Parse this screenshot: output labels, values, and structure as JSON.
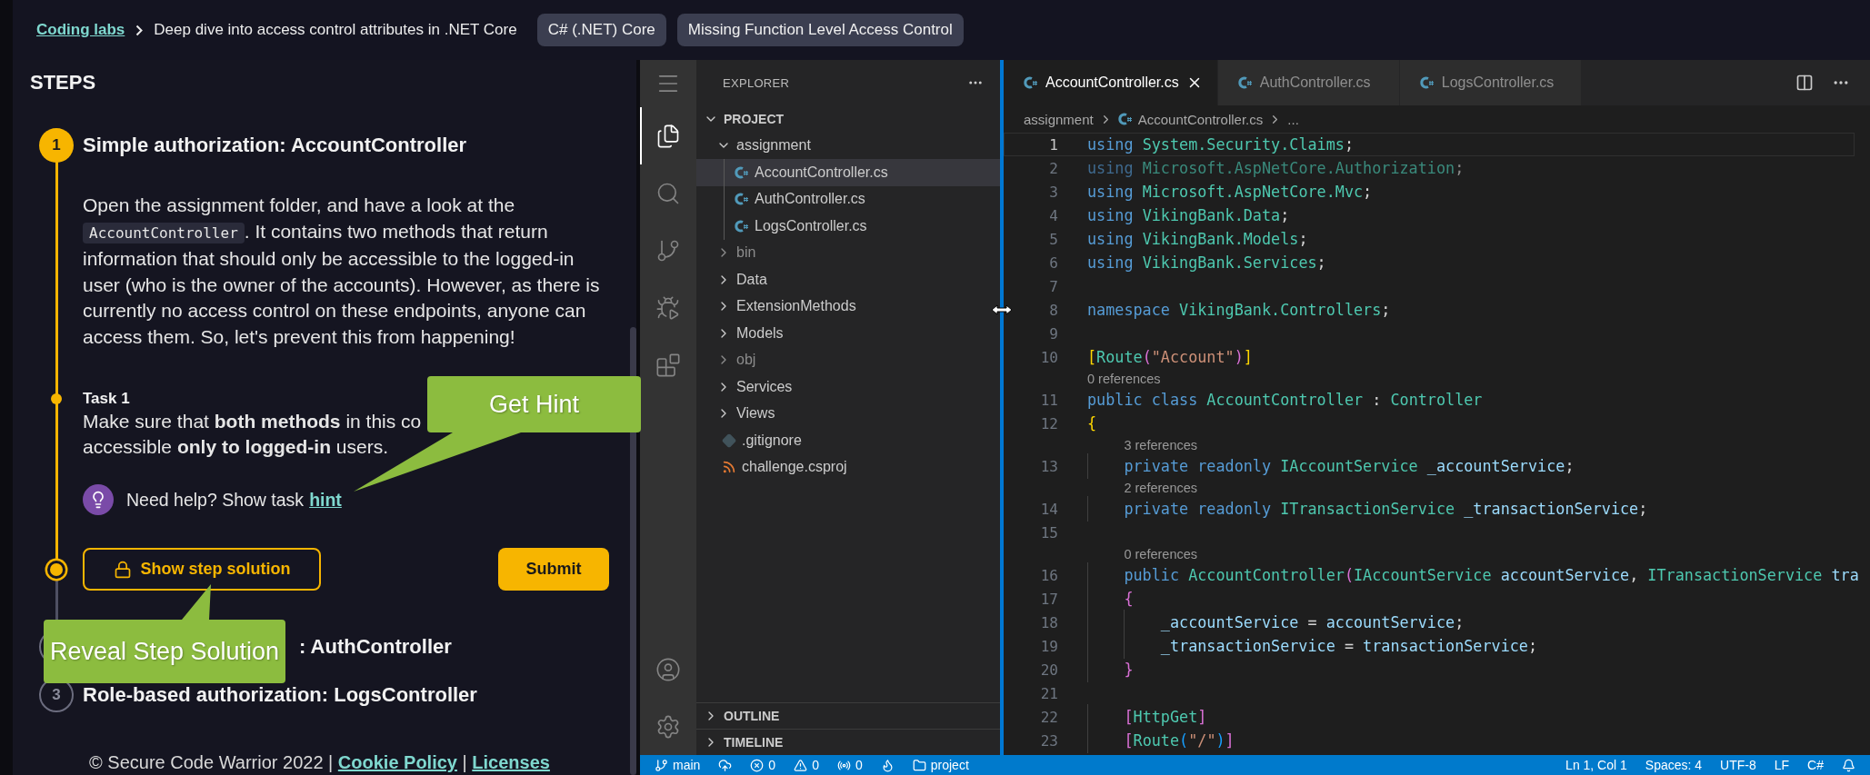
{
  "header": {
    "breadcrumb": {
      "link": "Coding labs",
      "current": "Deep dive into access control attributes in .NET Core"
    },
    "tags": [
      "C# (.NET) Core",
      "Missing Function Level Access Control"
    ]
  },
  "steps_panel": {
    "title": "STEPS",
    "steps": [
      {
        "number": "1",
        "title": "Simple authorization: AccountController",
        "active": true,
        "covered": false,
        "description": [
          {
            "kind": "text",
            "text": "Open the assignment folder, and have a look at the "
          },
          {
            "kind": "code",
            "text": "AccountController"
          },
          {
            "kind": "text",
            "text": ". It contains two methods that return information that should only be accessible to the logged-in user (who is the owner of the accounts). However, as there is currently no access control on these endpoints, anyone can access them. So, let's prevent this from happening!"
          }
        ],
        "task": {
          "label": "Task 1",
          "lines": [
            "Make sure that **both methods** in this co",
            "accessible **only to logged-in** users."
          ]
        },
        "hint": {
          "prompt": "Need help? Show task",
          "link": "hint"
        },
        "actions": [
          {
            "kind": "reveal",
            "label": "Show step solution"
          },
          {
            "kind": "submit",
            "label": "Submit"
          }
        ]
      },
      {
        "title": ": AuthController",
        "active": false,
        "covered": true
      },
      {
        "number": "3",
        "title": "Role-based authorization: LogsController",
        "active": false,
        "covered": false
      }
    ],
    "footer": [
      {
        "kind": "text",
        "text": "© Secure Code Warrior 2022 |"
      },
      {
        "kind": "link",
        "text": "Cookie Policy"
      },
      {
        "kind": "text",
        "text": "|"
      },
      {
        "kind": "link",
        "text": "Licenses"
      }
    ]
  },
  "callouts": [
    {
      "kind": "hint",
      "text": "Get Hint"
    },
    {
      "kind": "solution",
      "text": "Reveal Step Solution"
    }
  ],
  "ide": {
    "activity_bar": [
      {
        "kind": "menu",
        "selected": false
      },
      {
        "kind": "explorer",
        "selected": true
      },
      {
        "kind": "search",
        "selected": false
      },
      {
        "kind": "source-control",
        "selected": false
      },
      {
        "kind": "run-debug",
        "selected": false
      },
      {
        "kind": "extensions",
        "selected": false
      },
      {
        "kind": "accounts",
        "selected": false
      },
      {
        "kind": "settings",
        "selected": false
      }
    ],
    "explorer": {
      "title": "EXPLORER",
      "tree": [
        {
          "label": "PROJECT",
          "kind": "root",
          "expanded": true,
          "selected": false,
          "dimmed": false,
          "children": [
            {
              "label": "assignment",
              "kind": "folder",
              "expanded": true,
              "selected": false,
              "dimmed": false,
              "children": [
                {
                  "label": "AccountController.cs",
                  "kind": "csharp",
                  "selected": true,
                  "dimmed": false
                },
                {
                  "label": "AuthController.cs",
                  "kind": "csharp",
                  "selected": false,
                  "dimmed": false
                },
                {
                  "label": "LogsController.cs",
                  "kind": "csharp",
                  "selected": false,
                  "dimmed": false
                }
              ]
            },
            {
              "label": "bin",
              "kind": "folder",
              "expanded": false,
              "selected": false,
              "dimmed": true
            },
            {
              "label": "Data",
              "kind": "folder",
              "expanded": false,
              "selected": false,
              "dimmed": false
            },
            {
              "label": "ExtensionMethods",
              "kind": "folder",
              "expanded": false,
              "selected": false,
              "dimmed": false
            },
            {
              "label": "Models",
              "kind": "folder",
              "expanded": false,
              "selected": false,
              "dimmed": false
            },
            {
              "label": "obj",
              "kind": "folder",
              "expanded": false,
              "selected": false,
              "dimmed": true
            },
            {
              "label": "Services",
              "kind": "folder",
              "expanded": false,
              "selected": false,
              "dimmed": false
            },
            {
              "label": "Views",
              "kind": "folder",
              "expanded": false,
              "selected": false,
              "dimmed": false
            },
            {
              "label": ".gitignore",
              "kind": "git",
              "selected": false,
              "dimmed": false
            },
            {
              "label": "challenge.csproj",
              "kind": "project",
              "selected": false,
              "dimmed": false
            }
          ]
        }
      ],
      "sections": [
        {
          "label": "OUTLINE",
          "expanded": false
        },
        {
          "label": "TIMELINE",
          "expanded": false
        }
      ]
    },
    "tabs": [
      {
        "label": "AccountController.cs",
        "selected": true
      },
      {
        "label": "AuthController.cs",
        "selected": false
      },
      {
        "label": "LogsController.cs",
        "selected": false
      }
    ],
    "breadcrumb": [
      "assignment",
      "AccountController.cs",
      "..."
    ],
    "code": [
      {
        "kind": "code",
        "number": "1",
        "current": true,
        "unused": false,
        "tokens": [
          {
            "text": "using ",
            "kind": "kw"
          },
          {
            "text": "System.Security.Claims",
            "kind": "type"
          },
          {
            "text": ";",
            "kind": "plain"
          }
        ]
      },
      {
        "kind": "code",
        "number": "2",
        "current": false,
        "unused": true,
        "tokens": [
          {
            "text": "using ",
            "kind": "kw"
          },
          {
            "text": "Microsoft.AspNetCore.Authorization",
            "kind": "type"
          },
          {
            "text": ";",
            "kind": "plain"
          }
        ]
      },
      {
        "kind": "code",
        "number": "3",
        "current": false,
        "unused": false,
        "tokens": [
          {
            "text": "using ",
            "kind": "kw"
          },
          {
            "text": "Microsoft.AspNetCore.Mvc",
            "kind": "type"
          },
          {
            "text": ";",
            "kind": "plain"
          }
        ]
      },
      {
        "kind": "code",
        "number": "4",
        "current": false,
        "unused": false,
        "tokens": [
          {
            "text": "using ",
            "kind": "kw"
          },
          {
            "text": "VikingBank.Data",
            "kind": "type"
          },
          {
            "text": ";",
            "kind": "plain"
          }
        ]
      },
      {
        "kind": "code",
        "number": "5",
        "current": false,
        "unused": false,
        "tokens": [
          {
            "text": "using ",
            "kind": "kw"
          },
          {
            "text": "VikingBank.Models",
            "kind": "type"
          },
          {
            "text": ";",
            "kind": "plain"
          }
        ]
      },
      {
        "kind": "code",
        "number": "6",
        "current": false,
        "unused": false,
        "tokens": [
          {
            "text": "using ",
            "kind": "kw"
          },
          {
            "text": "VikingBank.Services",
            "kind": "type"
          },
          {
            "text": ";",
            "kind": "plain"
          }
        ]
      },
      {
        "kind": "code",
        "number": "7",
        "current": false
      },
      {
        "kind": "code",
        "number": "8",
        "current": false,
        "unused": false,
        "tokens": [
          {
            "text": "namespace ",
            "kind": "kw"
          },
          {
            "text": "VikingBank.Controllers",
            "kind": "type"
          },
          {
            "text": ";",
            "kind": "plain"
          }
        ]
      },
      {
        "kind": "code",
        "number": "9",
        "current": false
      },
      {
        "kind": "code",
        "number": "10",
        "current": false,
        "unused": false,
        "tokens": [
          {
            "text": "[",
            "kind": "bracket1"
          },
          {
            "text": "Route",
            "kind": "type"
          },
          {
            "text": "(",
            "kind": "bracket2"
          },
          {
            "text": "\"Account\"",
            "kind": "str"
          },
          {
            "text": ")",
            "kind": "bracket2"
          },
          {
            "text": "]",
            "kind": "bracket1"
          }
        ]
      },
      {
        "kind": "lens",
        "text": "0 references"
      },
      {
        "kind": "code",
        "number": "11",
        "current": false,
        "unused": false,
        "tokens": [
          {
            "text": "public class ",
            "kind": "kw"
          },
          {
            "text": "AccountController",
            "kind": "type"
          },
          {
            "text": " : ",
            "kind": "plain"
          },
          {
            "text": "Controller",
            "kind": "type"
          }
        ]
      },
      {
        "kind": "code",
        "number": "12",
        "current": false,
        "unused": false,
        "tokens": [
          {
            "text": "{",
            "kind": "bracket1"
          }
        ]
      },
      {
        "kind": "lens",
        "text": "3 references"
      },
      {
        "kind": "code",
        "number": "13",
        "current": false,
        "unused": false,
        "tokens": [
          {
            "text": "    private readonly ",
            "kind": "kw"
          },
          {
            "text": "IAccountService",
            "kind": "type"
          },
          {
            "text": " _accountService",
            "kind": "var"
          },
          {
            "text": ";",
            "kind": "plain"
          }
        ]
      },
      {
        "kind": "lens",
        "text": "2 references"
      },
      {
        "kind": "code",
        "number": "14",
        "current": false,
        "unused": false,
        "tokens": [
          {
            "text": "    private readonly ",
            "kind": "kw"
          },
          {
            "text": "ITransactionService",
            "kind": "type"
          },
          {
            "text": " _transactionService",
            "kind": "var"
          },
          {
            "text": ";",
            "kind": "plain"
          }
        ]
      },
      {
        "kind": "code",
        "number": "15",
        "current": false
      },
      {
        "kind": "lens",
        "text": "0 references"
      },
      {
        "kind": "code",
        "number": "16",
        "current": false,
        "unused": false,
        "tokens": [
          {
            "text": "    public ",
            "kind": "kw"
          },
          {
            "text": "AccountController",
            "kind": "type"
          },
          {
            "text": "(",
            "kind": "bracket2"
          },
          {
            "text": "IAccountService",
            "kind": "type"
          },
          {
            "text": " accountService",
            "kind": "var"
          },
          {
            "text": ", ",
            "kind": "plain"
          },
          {
            "text": "ITransactionService",
            "kind": "type"
          },
          {
            "text": " tra",
            "kind": "var"
          }
        ]
      },
      {
        "kind": "code",
        "number": "17",
        "current": false,
        "unused": false,
        "tokens": [
          {
            "text": "    {",
            "kind": "bracket2"
          }
        ]
      },
      {
        "kind": "code",
        "number": "18",
        "current": false,
        "unused": false,
        "tokens": [
          {
            "text": "        _accountService",
            "kind": "var"
          },
          {
            "text": " = ",
            "kind": "plain"
          },
          {
            "text": "accountService",
            "kind": "var"
          },
          {
            "text": ";",
            "kind": "plain"
          }
        ]
      },
      {
        "kind": "code",
        "number": "19",
        "current": false,
        "unused": false,
        "tokens": [
          {
            "text": "        _transactionService",
            "kind": "var"
          },
          {
            "text": " = ",
            "kind": "plain"
          },
          {
            "text": "transactionService",
            "kind": "var"
          },
          {
            "text": ";",
            "kind": "plain"
          }
        ]
      },
      {
        "kind": "code",
        "number": "20",
        "current": false,
        "unused": false,
        "tokens": [
          {
            "text": "    }",
            "kind": "bracket2"
          }
        ]
      },
      {
        "kind": "code",
        "number": "21",
        "current": false
      },
      {
        "kind": "code",
        "number": "22",
        "current": false,
        "unused": false,
        "tokens": [
          {
            "text": "    [",
            "kind": "bracket2"
          },
          {
            "text": "HttpGet",
            "kind": "type"
          },
          {
            "text": "]",
            "kind": "bracket2"
          }
        ]
      },
      {
        "kind": "code",
        "number": "23",
        "current": false,
        "unused": false,
        "tokens": [
          {
            "text": "    [",
            "kind": "bracket2"
          },
          {
            "text": "Route",
            "kind": "type"
          },
          {
            "text": "(",
            "kind": "bracket3"
          },
          {
            "text": "\"/\"",
            "kind": "str"
          },
          {
            "text": ")",
            "kind": "bracket3"
          },
          {
            "text": "]",
            "kind": "bracket2"
          }
        ]
      }
    ],
    "status_bar": {
      "left": [
        {
          "kind": "branch",
          "text": "main"
        },
        {
          "kind": "sync"
        },
        {
          "kind": "errors",
          "text": "0"
        },
        {
          "kind": "warnings",
          "text": "0"
        },
        {
          "kind": "ports",
          "text": "0"
        },
        {
          "kind": "flame"
        },
        {
          "kind": "folder",
          "text": "project"
        }
      ],
      "right": [
        {
          "kind": "text",
          "text": "Ln 1, Col 1"
        },
        {
          "kind": "text",
          "text": "Spaces: 4"
        },
        {
          "kind": "text",
          "text": "UTF-8"
        },
        {
          "kind": "text",
          "text": "LF"
        },
        {
          "kind": "text",
          "text": "C#"
        },
        {
          "kind": "bell"
        }
      ]
    }
  }
}
